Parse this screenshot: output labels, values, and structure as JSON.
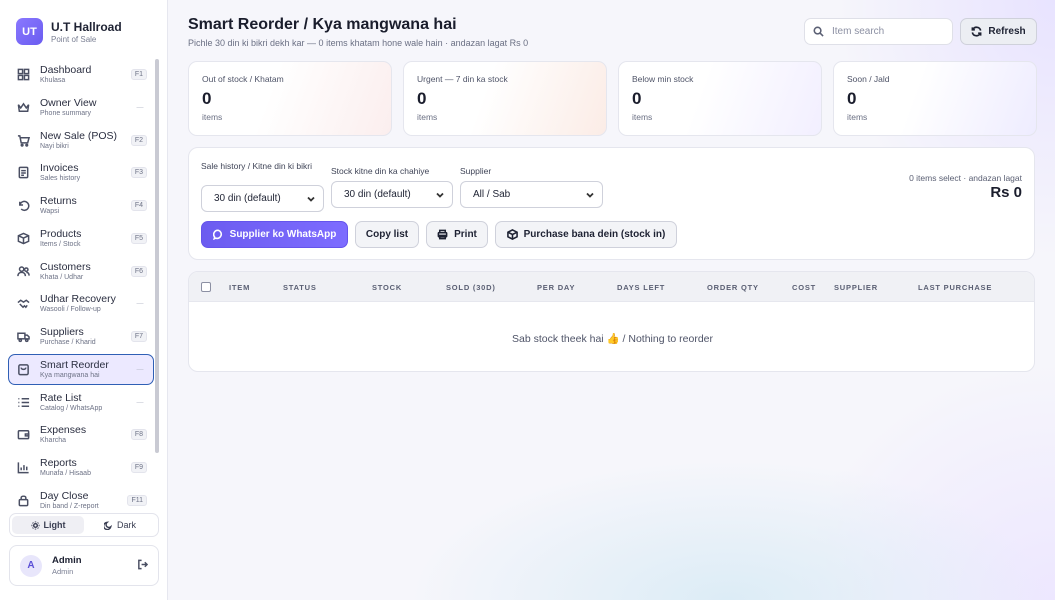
{
  "brand": {
    "logo": "UT",
    "name": "U.T Hallroad",
    "sub": "Point of Sale"
  },
  "nav": [
    {
      "label": "Dashboard",
      "sub": "Khulasa",
      "key": "F1",
      "icon": "dashboard-icon"
    },
    {
      "label": "Owner View",
      "sub": "Phone summary",
      "key": "—",
      "icon": "crown-icon"
    },
    {
      "label": "New Sale (POS)",
      "sub": "Nayi bikri",
      "key": "F2",
      "icon": "cart-icon"
    },
    {
      "label": "Invoices",
      "sub": "Sales history",
      "key": "F3",
      "icon": "invoice-icon"
    },
    {
      "label": "Returns",
      "sub": "Wapsi",
      "key": "F4",
      "icon": "return-icon"
    },
    {
      "label": "Products",
      "sub": "Items / Stock",
      "key": "F5",
      "icon": "box-icon"
    },
    {
      "label": "Customers",
      "sub": "Khata / Udhar",
      "key": "F6",
      "icon": "users-icon"
    },
    {
      "label": "Udhar Recovery",
      "sub": "Wasooli / Follow-up",
      "key": "—",
      "icon": "handshake-icon"
    },
    {
      "label": "Suppliers",
      "sub": "Purchase / Kharid",
      "key": "F7",
      "icon": "truck-icon"
    },
    {
      "label": "Smart Reorder",
      "sub": "Kya mangwana hai",
      "key": "—",
      "icon": "bag-icon",
      "active": true
    },
    {
      "label": "Rate List",
      "sub": "Catalog / WhatsApp",
      "key": "—",
      "icon": "list-icon"
    },
    {
      "label": "Expenses",
      "sub": "Kharcha",
      "key": "F8",
      "icon": "wallet-icon"
    },
    {
      "label": "Reports",
      "sub": "Munafa / Hisaab",
      "key": "F9",
      "icon": "chart-icon"
    },
    {
      "label": "Day Close",
      "sub": "Din band / Z-report",
      "key": "F11",
      "icon": "lock-icon"
    }
  ],
  "theme": {
    "light": "Light",
    "dark": "Dark"
  },
  "user": {
    "initial": "A",
    "name": "Admin",
    "role": "Admin"
  },
  "header": {
    "title": "Smart Reorder / Kya mangwana hai",
    "subtitle": "Pichle 30 din ki bikri dekh kar — 0 items khatam hone wale hain · andazan lagat Rs 0"
  },
  "search": {
    "placeholder": "Item search"
  },
  "refresh_label": "Refresh",
  "stats": [
    {
      "label": "Out of stock / Khatam",
      "value": "0",
      "unit": "items"
    },
    {
      "label": "Urgent — 7 din ka stock",
      "value": "0",
      "unit": "items"
    },
    {
      "label": "Below min stock",
      "value": "0",
      "unit": "items"
    },
    {
      "label": "Soon / Jald",
      "value": "0",
      "unit": "items"
    }
  ],
  "filters": {
    "history_label": "Sale history / Kitne din ki bikri",
    "history_value": "30 din (default)",
    "stock_label": "Stock kitne din ka chahiye",
    "stock_value": "30 din (default)",
    "supplier_label": "Supplier",
    "supplier_value": "All / Sab",
    "summary_note": "0 items select · andazan lagat",
    "summary_amount": "Rs 0"
  },
  "actions": {
    "whatsapp": "Supplier ko WhatsApp",
    "copy": "Copy list",
    "print": "Print",
    "purchase": "Purchase bana dein (stock in)"
  },
  "table": {
    "columns": [
      "ITEM",
      "STATUS",
      "STOCK",
      "SOLD (30D)",
      "PER DAY",
      "DAYS LEFT",
      "ORDER QTY",
      "COST",
      "SUPPLIER",
      "LAST PURCHASE"
    ],
    "empty": "Sab stock theek hai 👍 / Nothing to reorder"
  },
  "colors": {
    "accent": "#6c5cf0",
    "active_border": "#2f5fb5"
  }
}
